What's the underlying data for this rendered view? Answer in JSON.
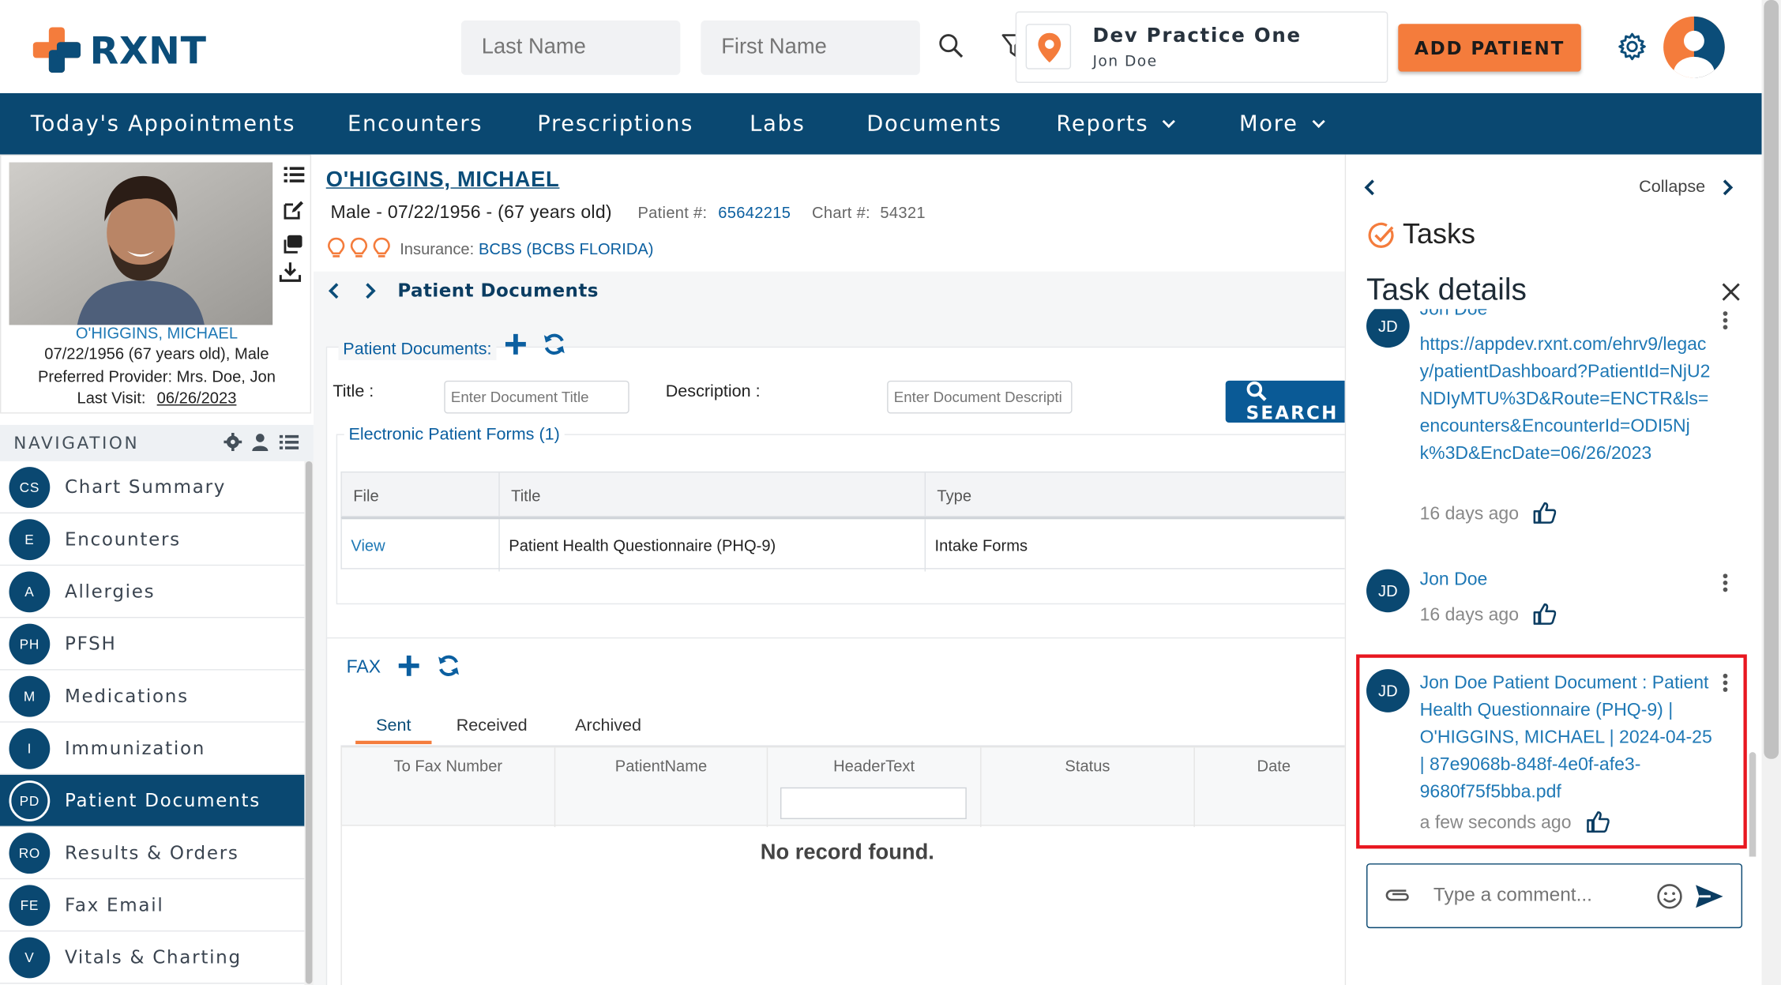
{
  "brand": {
    "logo_text": "RXNT",
    "accent": "#f47c3c",
    "primary": "#0a4871"
  },
  "header": {
    "last_name_placeholder": "Last Name",
    "first_name_placeholder": "First Name",
    "practice_name": "Dev Practice One",
    "practice_user": "Jon Doe",
    "add_patient_label": "ADD PATIENT"
  },
  "topnav": {
    "items": [
      {
        "label": "Today's Appointments"
      },
      {
        "label": "Encounters"
      },
      {
        "label": "Prescriptions"
      },
      {
        "label": "Labs"
      },
      {
        "label": "Documents"
      },
      {
        "label": "Reports"
      },
      {
        "label": "More"
      }
    ]
  },
  "patient_card": {
    "name": "O'HIGGINS, MICHAEL",
    "dob_line": "07/22/1956 (67 years old), Male",
    "provider_line": "Preferred Provider: Mrs. Doe, Jon",
    "last_visit_label": "Last Visit:",
    "last_visit_value": "06/26/2023"
  },
  "navigation": {
    "header": "NAVIGATION",
    "items": [
      {
        "badge": "CS",
        "label": "Chart Summary"
      },
      {
        "badge": "E",
        "label": "Encounters"
      },
      {
        "badge": "A",
        "label": "Allergies"
      },
      {
        "badge": "PH",
        "label": "PFSH"
      },
      {
        "badge": "M",
        "label": "Medications"
      },
      {
        "badge": "I",
        "label": "Immunization"
      },
      {
        "badge": "PD",
        "label": "Patient Documents"
      },
      {
        "badge": "RO",
        "label": "Results & Orders"
      },
      {
        "badge": "FE",
        "label": "Fax Email"
      },
      {
        "badge": "V",
        "label": "Vitals & Charting"
      }
    ],
    "active_index": 6
  },
  "patient": {
    "name": "O'HIGGINS, MICHAEL",
    "demographics": "Male - 07/22/1956 - (67 years old)",
    "patient_num_label": "Patient #:",
    "patient_num": "65642215",
    "chart_num_label": "Chart #:",
    "chart_num": "54321",
    "insurance_label": "Insurance:",
    "insurance_value": "BCBS (BCBS FLORIDA)"
  },
  "documents": {
    "breadcrumb_title": "Patient Documents",
    "section_title": "Patient Documents:",
    "title_label": "Title :",
    "title_placeholder": "Enter Document Title",
    "description_label": "Description :",
    "description_placeholder": "Enter Document Descripti",
    "search_label": "SEARCH",
    "forms_title": "Electronic Patient Forms (1)",
    "columns": [
      "File",
      "Title",
      "Type"
    ],
    "rows": [
      {
        "file": "View",
        "title": "Patient Health Questionnaire (PHQ-9)",
        "type": "Intake Forms"
      }
    ]
  },
  "fax": {
    "title": "FAX",
    "tabs": [
      "Sent",
      "Received",
      "Archived"
    ],
    "active_tab": "Sent",
    "columns": [
      "To Fax Number",
      "PatientName",
      "HeaderText",
      "Status",
      "Date"
    ],
    "empty_text": "No record found."
  },
  "tasks_panel": {
    "collapse_label": "Collapse",
    "title": "Tasks",
    "details_title": "Task details",
    "comments": [
      {
        "initials": "JD",
        "author": "Jon Doe",
        "text": "https://appdev.rxnt.com/ehrv9/legacy/patientDashboard?PatientId=NjU2NDIyMTU%3D&Route=ENCTR&ls=encounters&EncounterId=ODI5Njk%3D&EncDate=06/26/2023",
        "time": "16 days ago"
      },
      {
        "initials": "JD",
        "author": "Jon Doe",
        "text": "",
        "time": "16 days ago"
      },
      {
        "initials": "JD",
        "author": "",
        "text": "Jon Doe Patient Document : Patient Health Questionnaire (PHQ-9) | O'HIGGINS, MICHAEL | 2024-04-25 | 87e9068b-848f-4e0f-afe3-9680f75f5bba.pdf",
        "time": "a few seconds ago"
      }
    ],
    "comment_placeholder": "Type a comment..."
  }
}
